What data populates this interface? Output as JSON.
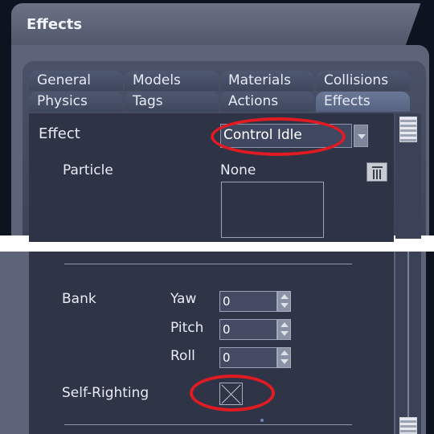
{
  "window": {
    "title": "Effects"
  },
  "tabs": {
    "row1": [
      "General",
      "Models",
      "Materials",
      "Collisions"
    ],
    "row2": [
      "Physics",
      "Tags",
      "Actions",
      "Effects"
    ],
    "active": "Effects"
  },
  "effect": {
    "label": "Effect",
    "value": "Control Idle"
  },
  "particle": {
    "label": "Particle",
    "value": "None"
  },
  "bank": {
    "label": "Bank",
    "rows": [
      {
        "label": "Yaw",
        "value": "0"
      },
      {
        "label": "Pitch",
        "value": "0"
      },
      {
        "label": "Roll",
        "value": "0"
      }
    ]
  },
  "self_righting": {
    "label": "Self-Righting",
    "checked": false
  },
  "colors": {
    "highlight": "#e01b22",
    "panel": "#5d6479",
    "content": "#2e3346"
  },
  "icons": [
    "chevron-down-icon",
    "trash-icon",
    "stepper-icon"
  ]
}
